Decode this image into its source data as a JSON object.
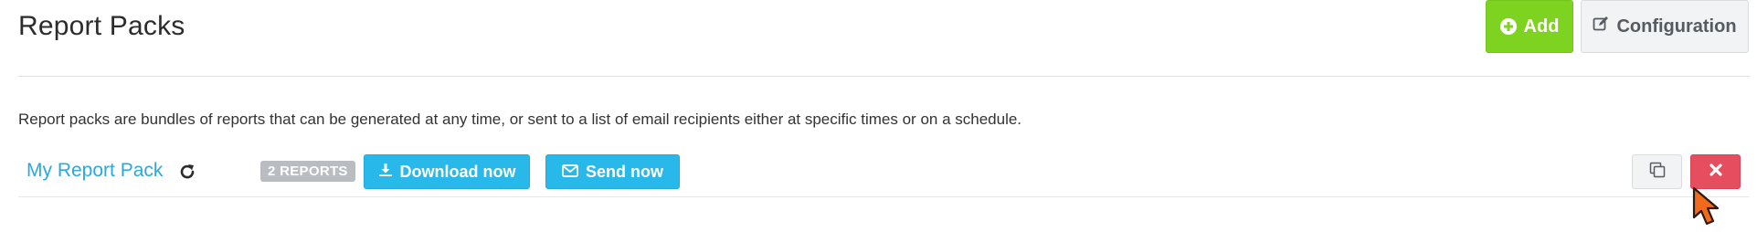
{
  "header": {
    "title": "Report Packs",
    "add_label": "Add",
    "configuration_label": "Configuration"
  },
  "description": "Report packs are bundles of reports that can be generated at any time, or sent to a list of email recipients either at specific times or on a schedule.",
  "report_packs": [
    {
      "name": "My Report Pack",
      "reports_badge": "2 REPORTS",
      "download_label": "Download now",
      "send_label": "Send now"
    }
  ],
  "icons": {
    "add": "plus-circle-icon",
    "configuration": "edit-icon",
    "refresh": "refresh-icon",
    "download": "download-icon",
    "send": "envelope-icon",
    "copy": "copy-icon",
    "delete": "close-icon"
  },
  "colors": {
    "add_green": "#7ed321",
    "link_blue": "#29a9df",
    "button_blue": "#29b8ea",
    "delete_red": "#e64e5f",
    "badge_gray": "#b9bcc1"
  }
}
